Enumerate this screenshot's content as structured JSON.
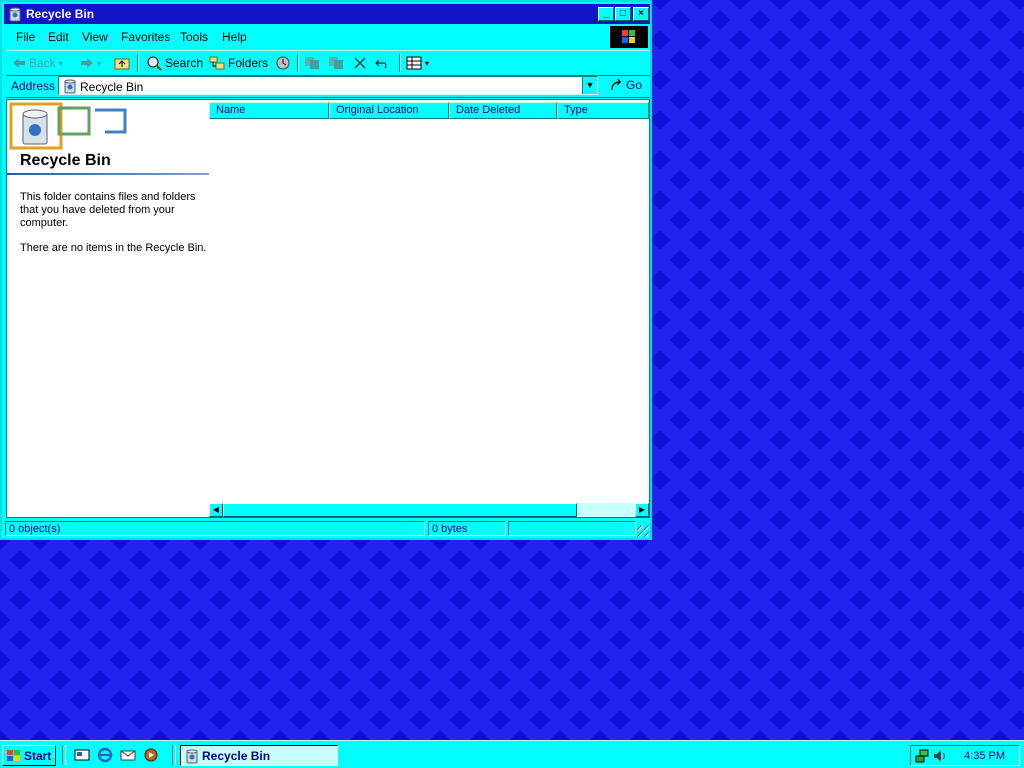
{
  "window": {
    "title": "Recycle Bin",
    "buttons": {
      "minimize": "_",
      "maximize": "□",
      "close": "×"
    }
  },
  "menu": [
    "File",
    "Edit",
    "View",
    "Favorites",
    "Tools",
    "Help"
  ],
  "toolbar": {
    "back": "Back",
    "search": "Search",
    "folders": "Folders"
  },
  "address": {
    "label": "Address",
    "value": "Recycle Bin",
    "go": "Go"
  },
  "left_pane": {
    "title": "Recycle Bin",
    "description": "This folder contains files and folders that you have deleted from your computer.",
    "empty_message": "There are no items in the Recycle Bin."
  },
  "columns": [
    "Name",
    "Original Location",
    "Date Deleted",
    "Type"
  ],
  "status": {
    "objects": "0 object(s)",
    "size": "0 bytes"
  },
  "taskbar": {
    "start": "Start",
    "task": "Recycle Bin",
    "clock": "4:35 PM"
  },
  "colors": {
    "title_bar": "#1414c8",
    "window_face": "#00ffff",
    "desktop": "#1010d8",
    "accent_text": "#000080"
  }
}
